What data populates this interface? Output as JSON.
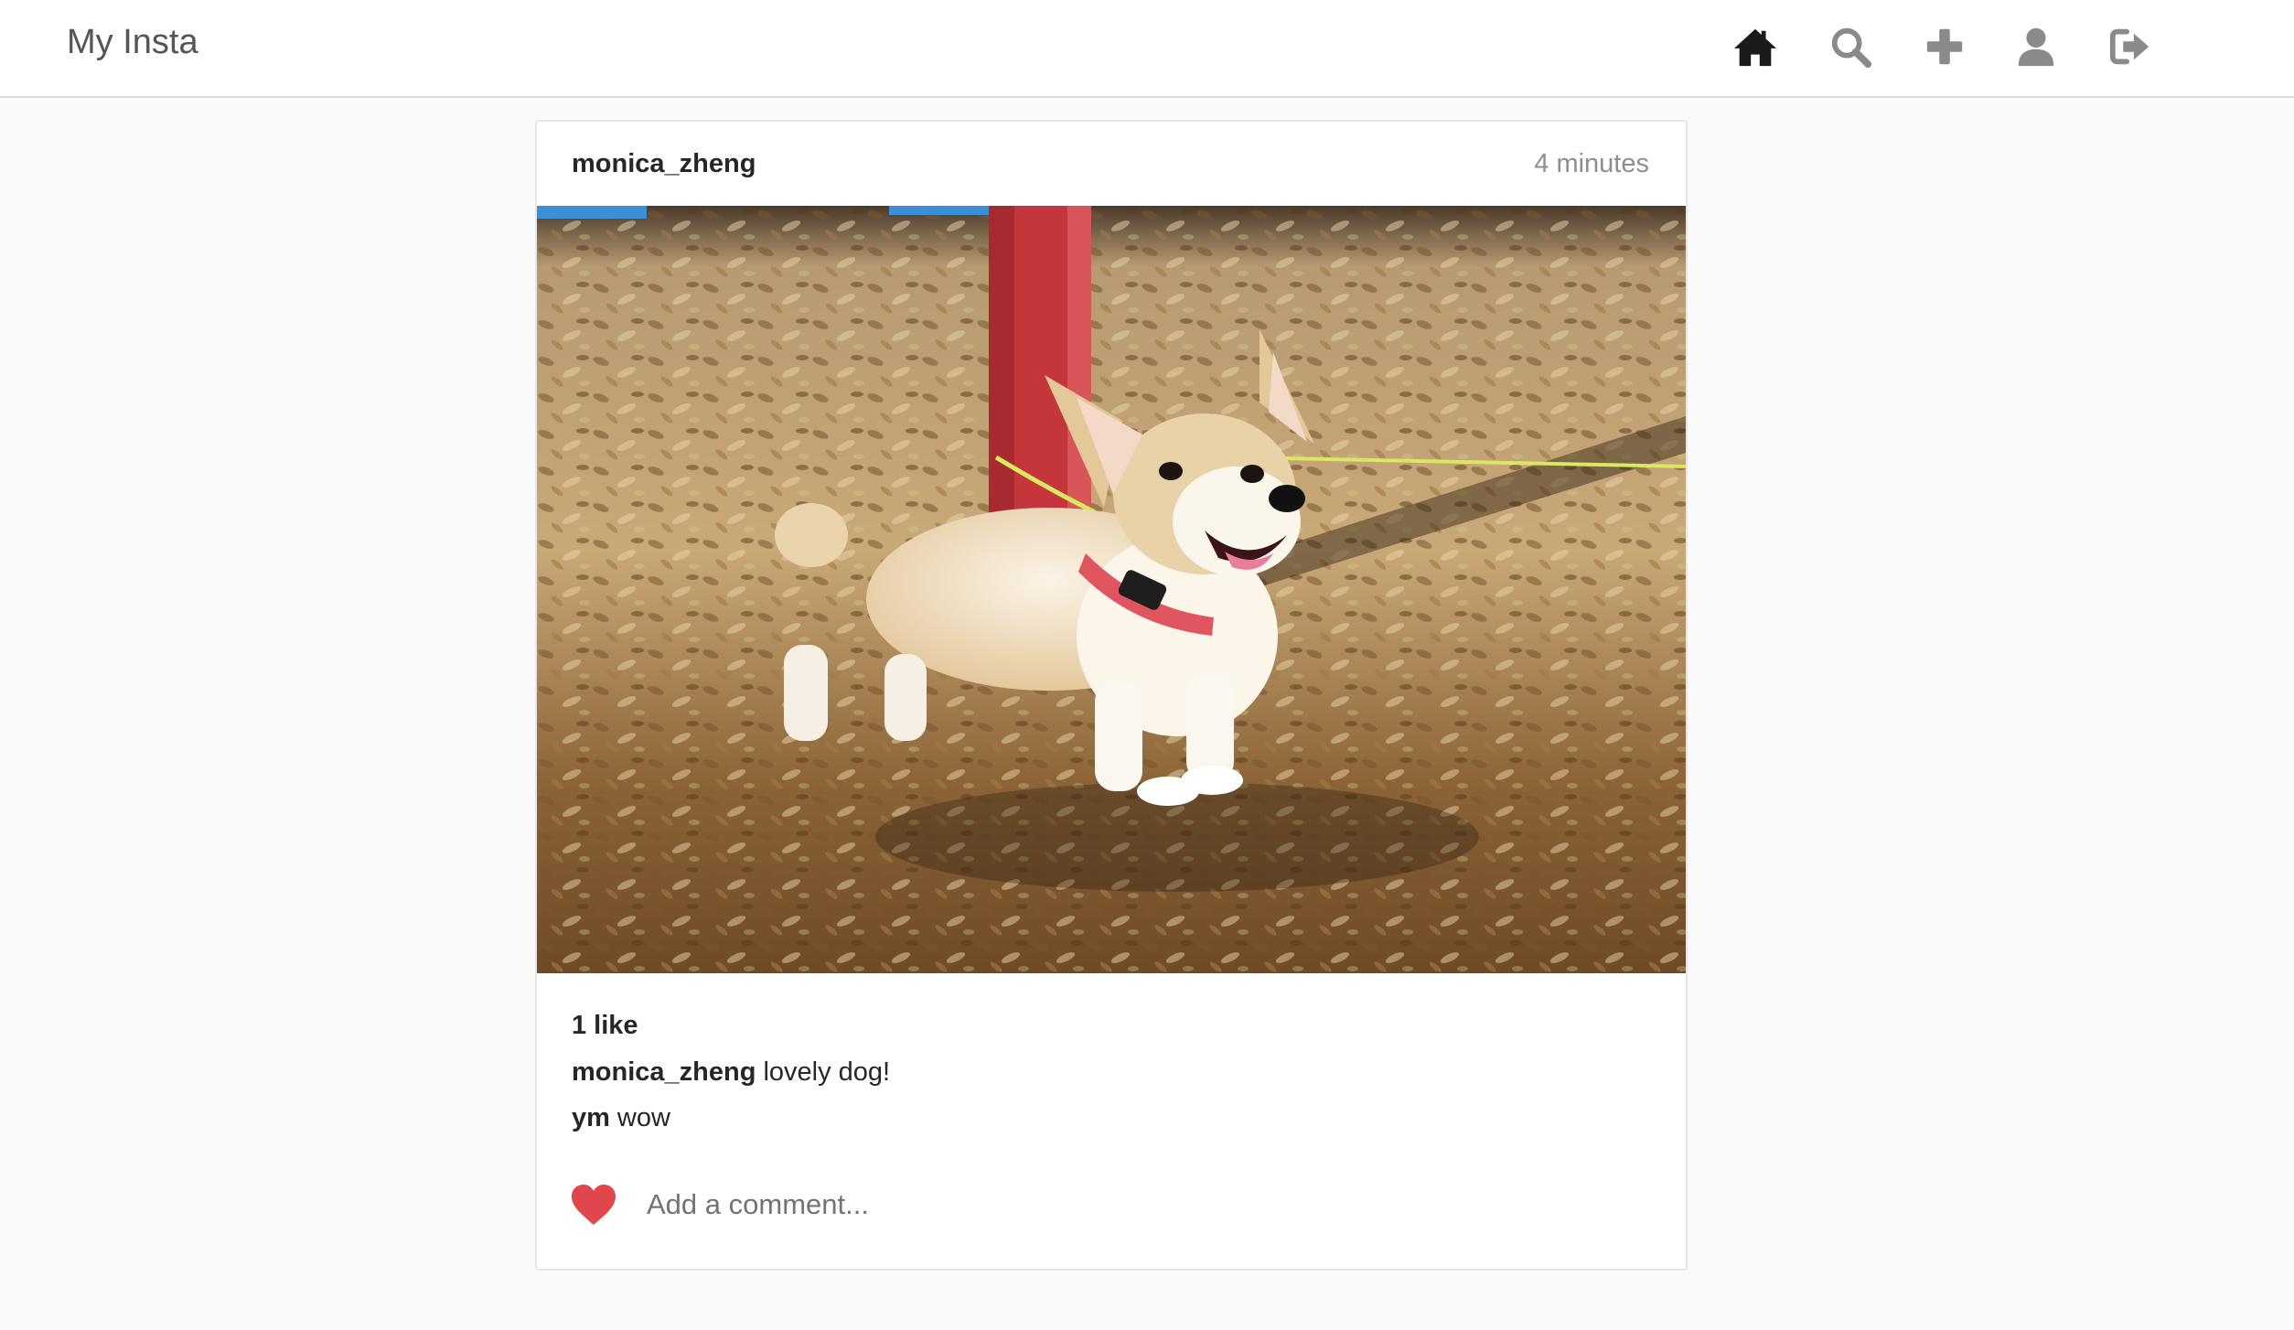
{
  "app": {
    "title": "My Insta"
  },
  "nav": {
    "icons": [
      "home-icon",
      "search-icon",
      "plus-icon",
      "user-icon",
      "logout-icon"
    ],
    "active_color": "#1a1a1a",
    "inactive_color": "#8a8a8a"
  },
  "post": {
    "username": "monica_zheng",
    "time": "4 minutes",
    "likes": "1 like",
    "comments": [
      {
        "author": "monica_zheng",
        "text": "lovely dog!"
      },
      {
        "author": "ym",
        "text": "wow"
      }
    ],
    "comment_placeholder": "Add a comment...",
    "heart_color": "#e0474c"
  }
}
